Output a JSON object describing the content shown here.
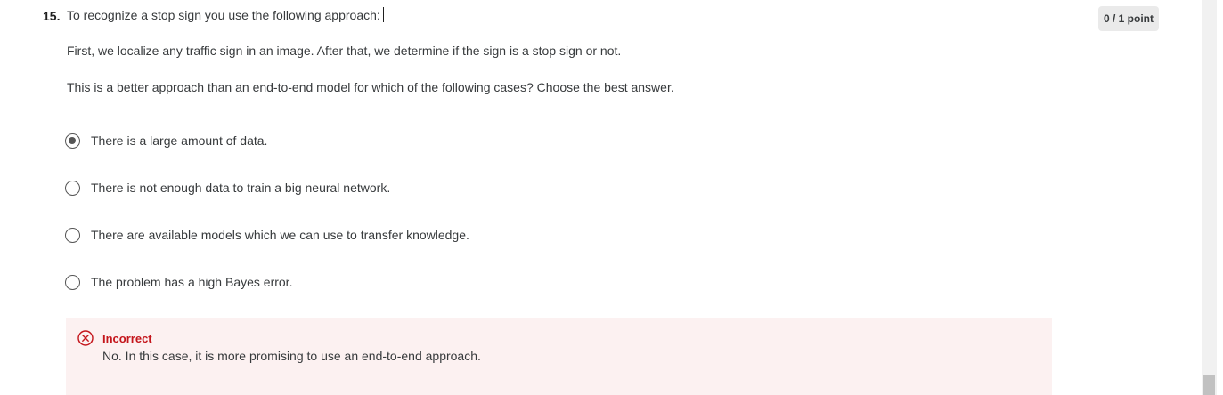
{
  "question": {
    "number": "15.",
    "prompt": "To recognize a stop sign you use the following approach:",
    "line2": "First, we localize any traffic sign in an image. After that, we determine if the sign is a stop sign or not.",
    "line3": "This is a better approach than an end-to-end model for which of the following cases? Choose the best answer.",
    "points": "0 / 1 point"
  },
  "options": [
    {
      "label": "There is a large amount of data.",
      "selected": true
    },
    {
      "label": "There is not enough data to train a big neural network.",
      "selected": false
    },
    {
      "label": "There are available models which we can use to transfer knowledge.",
      "selected": false
    },
    {
      "label": "The problem has a high Bayes error.",
      "selected": false
    }
  ],
  "feedback": {
    "status": "Incorrect",
    "icon": "close-circle-icon",
    "message": "No. In this case, it is more promising to use an end-to-end approach.",
    "accent_color": "#c4161c",
    "background_color": "#fcf1f1"
  }
}
